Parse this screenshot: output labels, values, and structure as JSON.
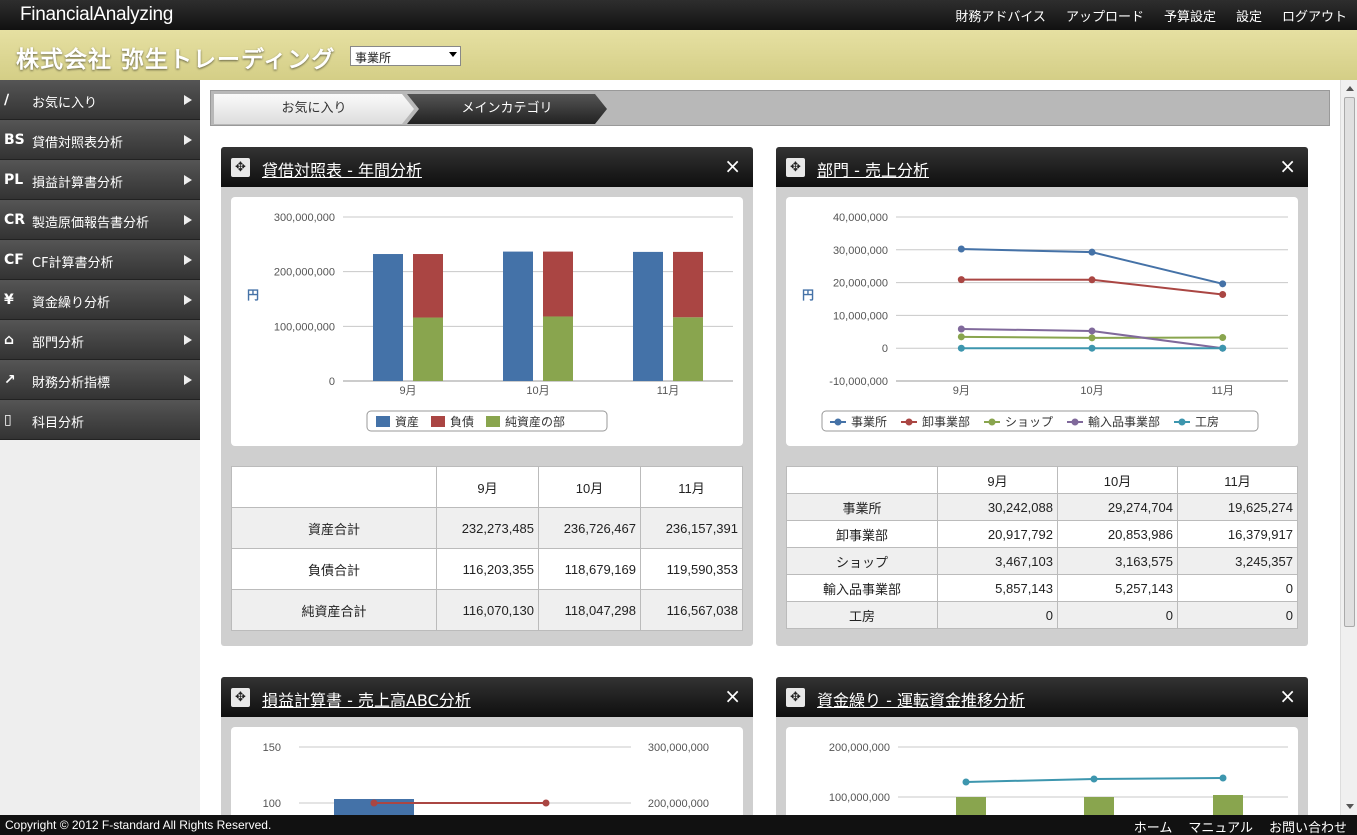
{
  "app": {
    "logo": "FinancialAnalyzing"
  },
  "topnav": [
    "財務アドバイス",
    "アップロード",
    "予算設定",
    "設定",
    "ログアウト"
  ],
  "company": {
    "name": "株式会社 弥生トレーディング",
    "office_selected": "事業所"
  },
  "sidebar": {
    "items": [
      {
        "label": "お気に入り",
        "icon": "pencil-icon",
        "glyph": "∕"
      },
      {
        "label": "貸借対照表分析",
        "icon": "bs-icon",
        "glyph": "BS"
      },
      {
        "label": "損益計算書分析",
        "icon": "pl-icon",
        "glyph": "PL"
      },
      {
        "label": "製造原価報告書分析",
        "icon": "cr-icon",
        "glyph": "CR"
      },
      {
        "label": "CF計算書分析",
        "icon": "cf-icon",
        "glyph": "CF"
      },
      {
        "label": "資金繰り分析",
        "icon": "yen-icon",
        "glyph": "¥"
      },
      {
        "label": "部門分析",
        "icon": "house-icon",
        "glyph": "⌂"
      },
      {
        "label": "財務分析指標",
        "icon": "line-chart-icon",
        "glyph": "↗"
      },
      {
        "label": "科目分析",
        "icon": "book-icon",
        "glyph": "▯"
      }
    ]
  },
  "breadcrumb": {
    "fav": "お気に入り",
    "main": "メインカテゴリ"
  },
  "panels": {
    "bs": {
      "title": "貸借対照表 - 年間分析",
      "close": "×",
      "table": {
        "headers": [
          "",
          "9月",
          "10月",
          "11月"
        ],
        "rows": [
          [
            "資産合計",
            "232,273,485",
            "236,726,467",
            "236,157,391"
          ],
          [
            "負債合計",
            "116,203,355",
            "118,679,169",
            "119,590,353"
          ],
          [
            "純資産合計",
            "116,070,130",
            "118,047,298",
            "116,567,038"
          ]
        ]
      }
    },
    "dept": {
      "title": "部門 - 売上分析",
      "close": "×",
      "table": {
        "headers": [
          "",
          "9月",
          "10月",
          "11月"
        ],
        "rows": [
          [
            "事業所",
            "30,242,088",
            "29,274,704",
            "19,625,274"
          ],
          [
            "卸事業部",
            "20,917,792",
            "20,853,986",
            "16,379,917"
          ],
          [
            "ショップ",
            "3,467,103",
            "3,163,575",
            "3,245,357"
          ],
          [
            "輸入品事業部",
            "5,857,143",
            "5,257,143",
            "0"
          ],
          [
            "工房",
            "0",
            "0",
            "0"
          ]
        ]
      }
    },
    "pl": {
      "title": "損益計算書 - 売上高ABC分析",
      "close": "×"
    },
    "cash": {
      "title": "資金繰り - 運転資金推移分析",
      "close": "×"
    }
  },
  "chart_data": [
    {
      "type": "bar",
      "categories": [
        "9月",
        "10月",
        "11月"
      ],
      "ylabel": "円",
      "ylim": [
        0,
        300000000
      ],
      "yticks": [
        "0",
        "100,000,000",
        "200,000,000",
        "300,000,000"
      ],
      "series": [
        {
          "name": "資産",
          "values": [
            232273485,
            236726467,
            236157391
          ],
          "color": "#4472a8"
        },
        {
          "name": "負債",
          "values": [
            116203355,
            118679169,
            119590353
          ],
          "color": "#aa4543",
          "stack": "liab"
        },
        {
          "name": "純資産の部",
          "values": [
            116070130,
            118047298,
            116567038
          ],
          "color": "#89a54e",
          "stack": "liab"
        }
      ],
      "legend": "bottom"
    },
    {
      "type": "line",
      "categories": [
        "9月",
        "10月",
        "11月"
      ],
      "ylabel": "円",
      "ylim": [
        -10000000,
        40000000
      ],
      "yticks": [
        "-10,000,000",
        "0",
        "10,000,000",
        "20,000,000",
        "30,000,000",
        "40,000,000"
      ],
      "series": [
        {
          "name": "事業所",
          "values": [
            30242088,
            29274704,
            19625274
          ],
          "color": "#4572a7"
        },
        {
          "name": "卸事業部",
          "values": [
            20917792,
            20853986,
            16379917
          ],
          "color": "#aa4643"
        },
        {
          "name": "ショップ",
          "values": [
            3467103,
            3163575,
            3245357
          ],
          "color": "#89a54e"
        },
        {
          "name": "輸入品事業部",
          "values": [
            5857143,
            5257143,
            0
          ],
          "color": "#80699b"
        },
        {
          "name": "工房",
          "values": [
            0,
            0,
            0
          ],
          "color": "#3d96ae"
        }
      ],
      "legend": "bottom"
    },
    {
      "type": "bar",
      "left_ticks": [
        "100",
        "150"
      ],
      "right_ticks": [
        "200,000,000",
        "300,000,000"
      ],
      "bar_color": "#4472a8",
      "line_color": "#aa4643"
    },
    {
      "type": "bar",
      "yticks": [
        "100,000,000",
        "200,000,000"
      ],
      "bar_color": "#89a54e",
      "line_color": "#3d96ae"
    }
  ],
  "footer": {
    "copyright": "Copyright © 2012 F-standard All Rights Reserved.",
    "links": [
      "ホーム",
      "マニュアル",
      "お問い合わせ"
    ]
  }
}
